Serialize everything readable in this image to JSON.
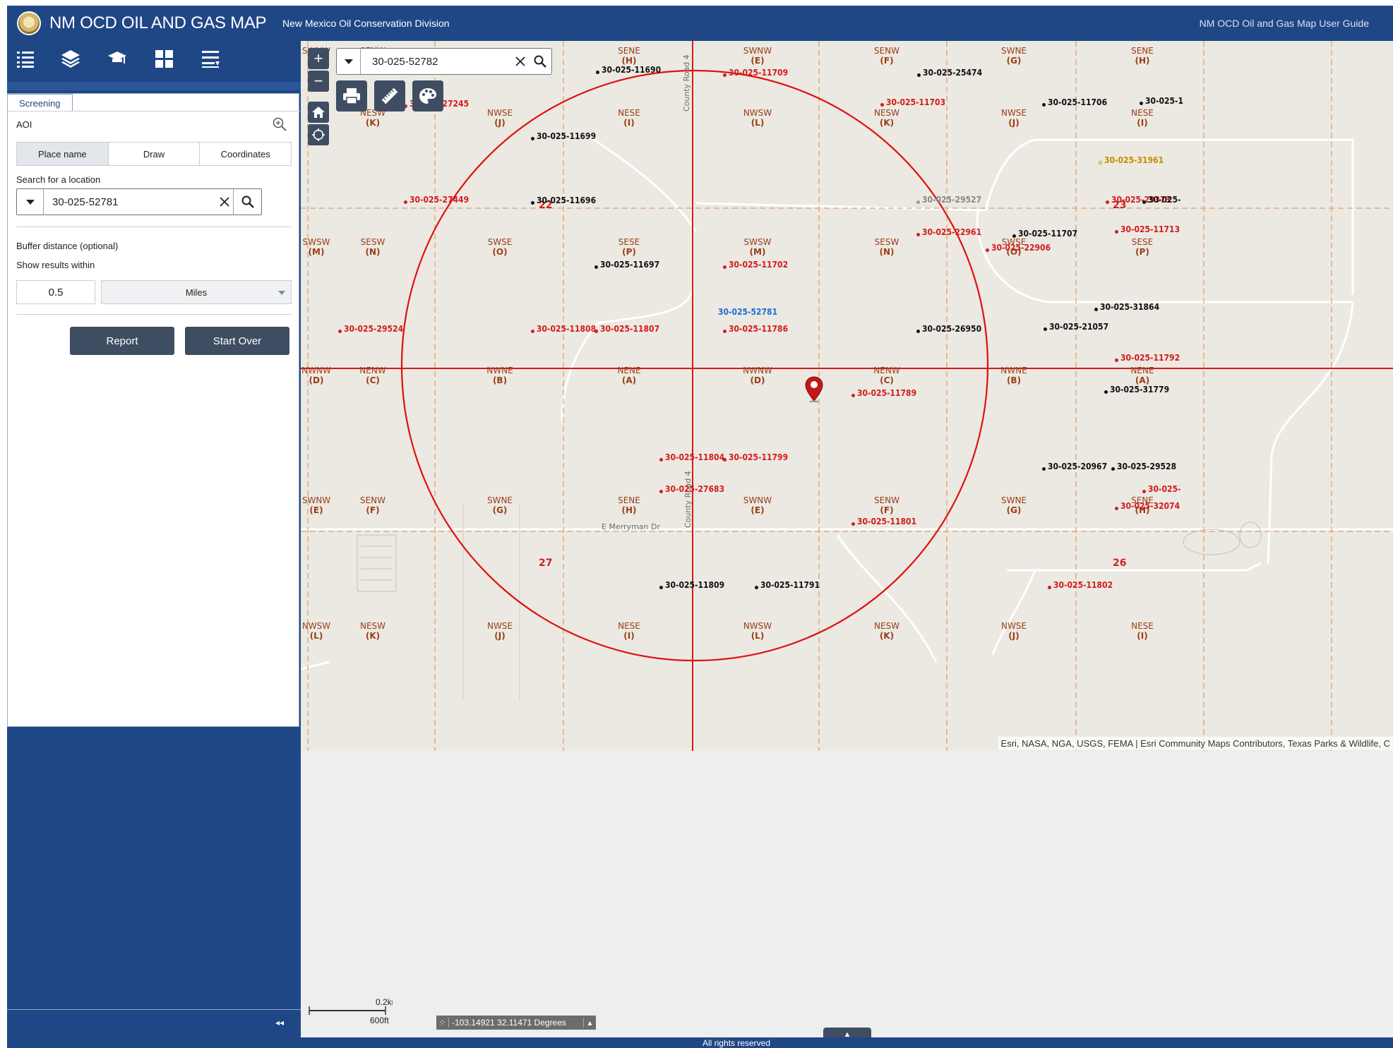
{
  "header": {
    "title": "NM OCD OIL AND GAS MAP",
    "subtitle": "New Mexico Oil Conservation Division",
    "user_guide": "NM OCD Oil and Gas Map User Guide"
  },
  "toolbar": {
    "icons": [
      "list-icon",
      "layers-icon",
      "screening-icon",
      "grid-icon",
      "menu-icon"
    ]
  },
  "panel": {
    "tab_label": "Screening",
    "aoi_label": "AOI",
    "segments": [
      "Place name",
      "Draw",
      "Coordinates"
    ],
    "active_segment": "Place name",
    "search_label": "Search for a location",
    "search_value": "30-025-52781",
    "buffer_label": "Buffer distance (optional)",
    "within_label": "Show results within",
    "buffer_value": "0.5",
    "buffer_unit": "Miles",
    "report_label": "Report",
    "start_over_label": "Start Over",
    "collapse_glyph": "◂◂"
  },
  "map": {
    "search_value": "30-025-52782",
    "attribution": "Esri, NASA, NGA, USGS, FEMA | Esri Community Maps Contributors, Texas Parks & Wildlife, C",
    "zoom_in": "+",
    "zoom_out": "−",
    "road_labels": [
      "County Road 4",
      "County Road 4",
      "E Merryman Dr"
    ],
    "section_numbers": [
      "22",
      "23",
      "27",
      "26"
    ],
    "sections": [
      [
        "SWNW",
        "M"
      ],
      [
        "SENW",
        "F"
      ],
      [
        "SENE",
        "H"
      ],
      [
        "SWNW",
        "E"
      ],
      [
        "SENW",
        "F"
      ],
      [
        "SWNE",
        "G"
      ],
      [
        "SENE",
        "H"
      ],
      [
        "NESW",
        "K"
      ],
      [
        "NWSE",
        "J"
      ],
      [
        "NESE",
        "I"
      ],
      [
        "NWSW",
        "L"
      ],
      [
        "NESW",
        "K"
      ],
      [
        "NWSE",
        "J"
      ],
      [
        "NESE",
        "I"
      ],
      [
        "SWSW",
        "M"
      ],
      [
        "SESW",
        "N"
      ],
      [
        "SWSE",
        "O"
      ],
      [
        "SESE",
        "P"
      ],
      [
        "SWSW",
        "M"
      ],
      [
        "SESW",
        "N"
      ],
      [
        "SWSE",
        "O"
      ],
      [
        "SESE",
        "P"
      ],
      [
        "NWNW",
        "D"
      ],
      [
        "NENW",
        "C"
      ],
      [
        "NWNE",
        "B"
      ],
      [
        "NENE",
        "A"
      ],
      [
        "NWNW",
        "D"
      ],
      [
        "NENW",
        "C"
      ],
      [
        "NWNE",
        "B"
      ],
      [
        "NENE",
        "A"
      ],
      [
        "SWNW",
        "E"
      ],
      [
        "SENW",
        "F"
      ],
      [
        "SWNE",
        "G"
      ],
      [
        "SENE",
        "H"
      ],
      [
        "SWNW",
        "E"
      ],
      [
        "SENW",
        "F"
      ],
      [
        "SWNE",
        "G"
      ],
      [
        "SENE",
        "H"
      ],
      [
        "NWSW",
        "L"
      ],
      [
        "NESW",
        "K"
      ],
      [
        "NWSE",
        "J"
      ],
      [
        "NESE",
        "I"
      ],
      [
        "NWSW",
        "L"
      ],
      [
        "NESW",
        "K"
      ],
      [
        "NWSE",
        "J"
      ],
      [
        "NESE",
        "I"
      ]
    ],
    "wells": [
      {
        "id": "30-025-11690",
        "status": "active"
      },
      {
        "id": "30-025-11709",
        "status": "plugged"
      },
      {
        "id": "30-025-25474",
        "status": "active"
      },
      {
        "id": "30-025-27245",
        "status": "plugged"
      },
      {
        "id": "30-025-11703",
        "status": "plugged"
      },
      {
        "id": "30-025-11706",
        "status": "active"
      },
      {
        "id": "30-025-1",
        "status": "active"
      },
      {
        "id": "30-025-11699",
        "status": "active"
      },
      {
        "id": "30-025-31961",
        "status": "new"
      },
      {
        "id": "30-025-27449",
        "status": "plugged"
      },
      {
        "id": "30-025-11696",
        "status": "active"
      },
      {
        "id": "30-025-29527",
        "status": "gray"
      },
      {
        "id": "30-025-29373",
        "status": "plugged"
      },
      {
        "id": "30-025-",
        "status": "active"
      },
      {
        "id": "30-025-22961",
        "status": "plugged"
      },
      {
        "id": "30-025-11707",
        "status": "active"
      },
      {
        "id": "30-025-22906",
        "status": "plugged"
      },
      {
        "id": "30-025-11713",
        "status": "plugged"
      },
      {
        "id": "30-025-11697",
        "status": "active"
      },
      {
        "id": "30-025-11702",
        "status": "plugged"
      },
      {
        "id": "30-025-31864",
        "status": "active"
      },
      {
        "id": "30-025-52781",
        "status": "target"
      },
      {
        "id": "30-025-29524",
        "status": "plugged"
      },
      {
        "id": "30-025-11808",
        "status": "plugged"
      },
      {
        "id": "30-025-11807",
        "status": "plugged"
      },
      {
        "id": "30-025-11786",
        "status": "plugged"
      },
      {
        "id": "30-025-26950",
        "status": "active"
      },
      {
        "id": "30-025-21057",
        "status": "active"
      },
      {
        "id": "30-025-11792",
        "status": "plugged"
      },
      {
        "id": "30-025-11789",
        "status": "plugged"
      },
      {
        "id": "30-025-31779",
        "status": "active"
      },
      {
        "id": "30-025-11804",
        "status": "plugged"
      },
      {
        "id": "30-025-11799",
        "status": "plugged"
      },
      {
        "id": "30-025-20967",
        "status": "active"
      },
      {
        "id": "30-025-29528",
        "status": "active"
      },
      {
        "id": "30-025-27683",
        "status": "plugged"
      },
      {
        "id": "30-025-",
        "status": "plugged"
      },
      {
        "id": "30-025-32074",
        "status": "plugged"
      },
      {
        "id": "30-025-11801",
        "status": "plugged"
      },
      {
        "id": "30-025-11809",
        "status": "active"
      },
      {
        "id": "30-025-11791",
        "status": "active"
      },
      {
        "id": "30-025-11802",
        "status": "plugged"
      }
    ]
  },
  "status": {
    "scale_km": "0.2km",
    "scale_ft": "600ft",
    "coordinates": "-103.14921 32.11471 Degrees",
    "footer": "All rights reserved"
  },
  "colors": {
    "brand": "#1f4786",
    "button": "#3f4d62",
    "buffer": "#e01010",
    "plugged": "#d31d1d",
    "active": "#111111",
    "section": "#9b3d16"
  }
}
